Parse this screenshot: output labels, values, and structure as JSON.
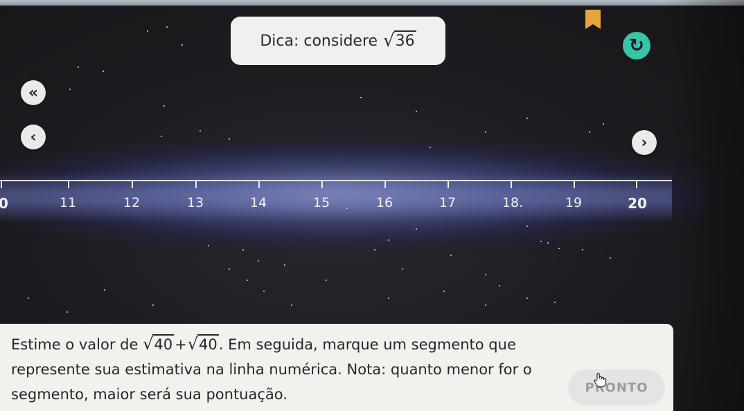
{
  "hint": {
    "label": "Dica: considere",
    "radicand": "36"
  },
  "nav": {
    "back_icon": "double-chevron-left",
    "prev_icon": "chevron-left",
    "next_icon": "chevron-right",
    "reset_icon": "reset-icon",
    "bookmark_icon": "bookmark-icon"
  },
  "number_line": {
    "start_label": "0",
    "ticks": [
      "11",
      "12",
      "13",
      "14",
      "15",
      "16",
      "17",
      "18.",
      "19",
      "20"
    ]
  },
  "question": {
    "part1": "Estime o valor de",
    "radicand_a": "40",
    "plus": "+",
    "radicand_b": "40",
    "part2": ". Em seguida, marque um segmento que represente sua estimativa na linha numérica. Nota: quanto menor for o segmento, maior será sua pontuação."
  },
  "ready_button": {
    "label": "PRONTO"
  },
  "colors": {
    "accent": "#38c4a8",
    "bookmark": "#e7a43a",
    "panel": "#f1f1ee",
    "background": "#1e1c1f"
  }
}
